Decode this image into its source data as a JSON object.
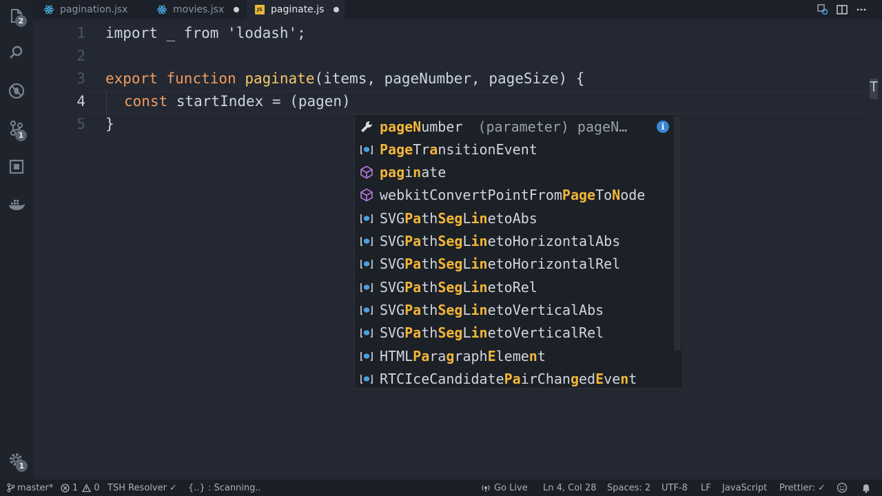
{
  "tabs": [
    {
      "label": "pagination.jsx",
      "icon": "react-icon",
      "modified": false
    },
    {
      "label": "movies.jsx",
      "icon": "react-icon",
      "modified": true
    },
    {
      "label": "paginate.js",
      "icon": "js-icon",
      "icon_text": "JS",
      "modified": true,
      "active": true
    }
  ],
  "activity": {
    "explorer_badge": "2",
    "scm_badge": "1",
    "settings_badge": "1"
  },
  "editor": {
    "line_numbers": [
      "1",
      "2",
      "3",
      "4",
      "5"
    ],
    "line1": {
      "kw": "import",
      "mid": " _ ",
      "kw2": "from",
      "str": " 'lodash';"
    },
    "line3": {
      "kw1": "export",
      "kw2": "function",
      "fn": "paginate",
      "params": "(items, pageNumber, pageSize) {"
    },
    "line4": {
      "kw": "const",
      "rest": " startIndex = (pagen)"
    },
    "line5": "}",
    "minimap_mark": "T"
  },
  "suggestions": [
    {
      "icon": "wrench-icon",
      "pre": "",
      "hl1": "pageN",
      "mid": "umber",
      "detail": "(parameter) pageN…",
      "selected": true
    },
    {
      "icon": "field-icon",
      "parts": [
        [
          "Page",
          true
        ],
        [
          "Tr",
          false
        ],
        [
          "a",
          true
        ],
        [
          "nsitionEvent",
          false
        ]
      ]
    },
    {
      "icon": "cube-icon",
      "parts": [
        [
          "pag",
          true
        ],
        [
          "i",
          false
        ],
        [
          "n",
          true
        ],
        [
          "ate",
          false
        ]
      ]
    },
    {
      "icon": "cube-icon",
      "parts": [
        [
          "webkitConvertPointFrom",
          false
        ],
        [
          "Page",
          true
        ],
        [
          "To",
          false
        ],
        [
          "N",
          true
        ],
        [
          "ode",
          false
        ]
      ]
    },
    {
      "icon": "field-icon",
      "parts": [
        [
          "SVG",
          false
        ],
        [
          "Pa",
          true
        ],
        [
          "th",
          false
        ],
        [
          "Seg",
          true
        ],
        [
          "L",
          false
        ],
        [
          "in",
          true
        ],
        [
          "etoAbs",
          false
        ]
      ]
    },
    {
      "icon": "field-icon",
      "parts": [
        [
          "SVG",
          false
        ],
        [
          "Pa",
          true
        ],
        [
          "th",
          false
        ],
        [
          "Seg",
          true
        ],
        [
          "L",
          false
        ],
        [
          "in",
          true
        ],
        [
          "etoHorizontalAbs",
          false
        ]
      ]
    },
    {
      "icon": "field-icon",
      "parts": [
        [
          "SVG",
          false
        ],
        [
          "Pa",
          true
        ],
        [
          "th",
          false
        ],
        [
          "Seg",
          true
        ],
        [
          "L",
          false
        ],
        [
          "in",
          true
        ],
        [
          "etoHorizontalRel",
          false
        ]
      ]
    },
    {
      "icon": "field-icon",
      "parts": [
        [
          "SVG",
          false
        ],
        [
          "Pa",
          true
        ],
        [
          "th",
          false
        ],
        [
          "Seg",
          true
        ],
        [
          "L",
          false
        ],
        [
          "in",
          true
        ],
        [
          "etoRel",
          false
        ]
      ]
    },
    {
      "icon": "field-icon",
      "parts": [
        [
          "SVG",
          false
        ],
        [
          "Pa",
          true
        ],
        [
          "th",
          false
        ],
        [
          "Seg",
          true
        ],
        [
          "L",
          false
        ],
        [
          "in",
          true
        ],
        [
          "etoVerticalAbs",
          false
        ]
      ]
    },
    {
      "icon": "field-icon",
      "parts": [
        [
          "SVG",
          false
        ],
        [
          "Pa",
          true
        ],
        [
          "th",
          false
        ],
        [
          "Seg",
          true
        ],
        [
          "L",
          false
        ],
        [
          "in",
          true
        ],
        [
          "etoVerticalRel",
          false
        ]
      ]
    },
    {
      "icon": "field-icon",
      "parts": [
        [
          "HTML",
          false
        ],
        [
          "Pa",
          true
        ],
        [
          "ra",
          false
        ],
        [
          "g",
          true
        ],
        [
          "raph",
          false
        ],
        [
          "E",
          true
        ],
        [
          "leme",
          false
        ],
        [
          "n",
          true
        ],
        [
          "t",
          false
        ]
      ]
    },
    {
      "icon": "field-icon",
      "parts": [
        [
          "RTCIceCandidate",
          false
        ],
        [
          "Pa",
          true
        ],
        [
          "irChan",
          false
        ],
        [
          "g",
          true
        ],
        [
          "ed",
          false
        ],
        [
          "E",
          true
        ],
        [
          "ve",
          false
        ],
        [
          "n",
          true
        ],
        [
          "t",
          false
        ]
      ]
    }
  ],
  "info_icon_text": "i",
  "status": {
    "branch": "master*",
    "errors": "1",
    "warnings": "0",
    "resolver": "TSH Resolver ✓",
    "scanning": "{..} : Scanning..",
    "go_live": "Go Live",
    "position": "Ln 4, Col 28",
    "spaces": "Spaces: 2",
    "encoding": "UTF-8",
    "eol": "LF",
    "language": "JavaScript",
    "prettier": "Prettier: ✓"
  }
}
